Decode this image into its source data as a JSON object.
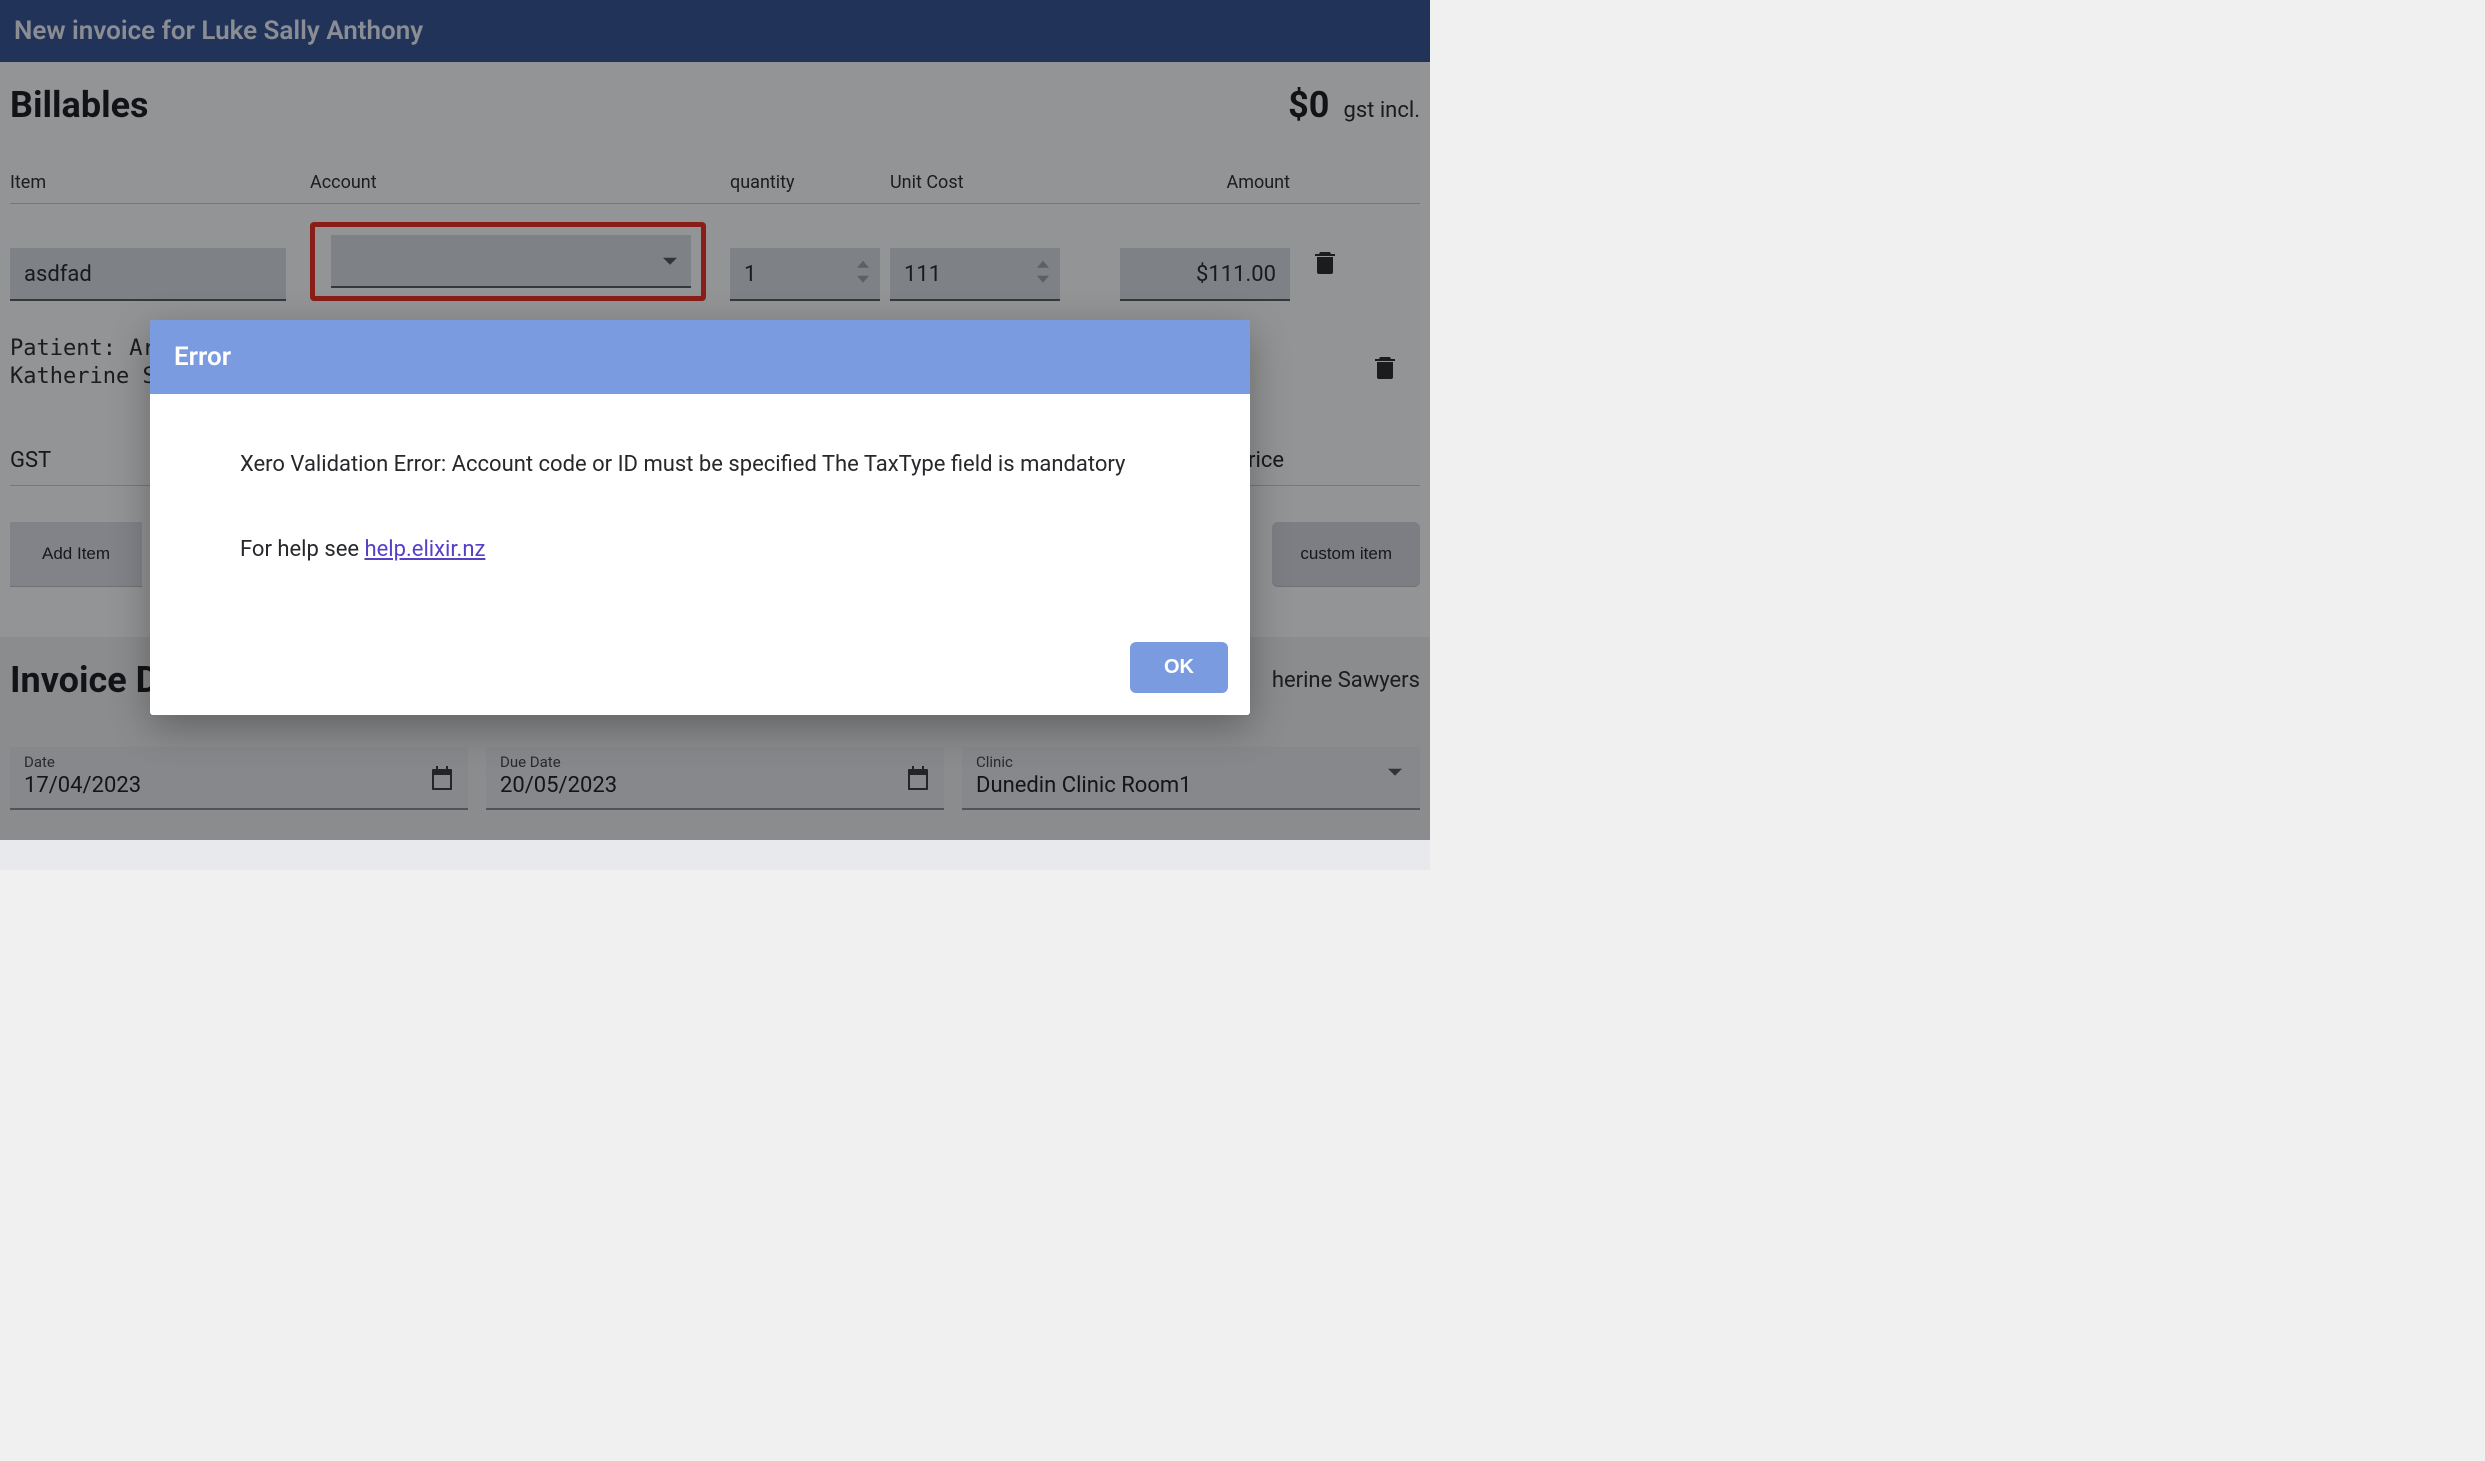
{
  "header": {
    "title": "New invoice for Luke Sally Anthony"
  },
  "billables": {
    "heading": "Billables",
    "total_amount": "$0",
    "total_suffix": "gst incl.",
    "columns": {
      "item": "Item",
      "account": "Account",
      "quantity": "quantity",
      "unit_cost": "Unit Cost",
      "amount": "Amount"
    },
    "rows": [
      {
        "item": "asdfad",
        "account": "",
        "quantity": "1",
        "unit_cost": "111",
        "amount": "$111.00"
      }
    ],
    "patient_line1": "Patient: Ar",
    "patient_line2": "Katherine S",
    "gst_label": "GST",
    "gst_price_label": "m price",
    "add_item_label": "Add Item",
    "custom_item_label": "custom item"
  },
  "invoice_details": {
    "heading_partial": "Invoice D",
    "right_text": "herine Sawyers",
    "date": {
      "label": "Date",
      "value": "17/04/2023"
    },
    "due_date": {
      "label": "Due Date",
      "value": "20/05/2023"
    },
    "clinic": {
      "label": "Clinic",
      "value": "Dunedin Clinic Room1"
    }
  },
  "dialog": {
    "title": "Error",
    "message": "Xero Validation Error: Account code or ID must be specified The TaxType field is mandatory",
    "help_prefix": "For help see ",
    "help_link_text": "help.elixir.nz",
    "ok_label": "OK"
  }
}
